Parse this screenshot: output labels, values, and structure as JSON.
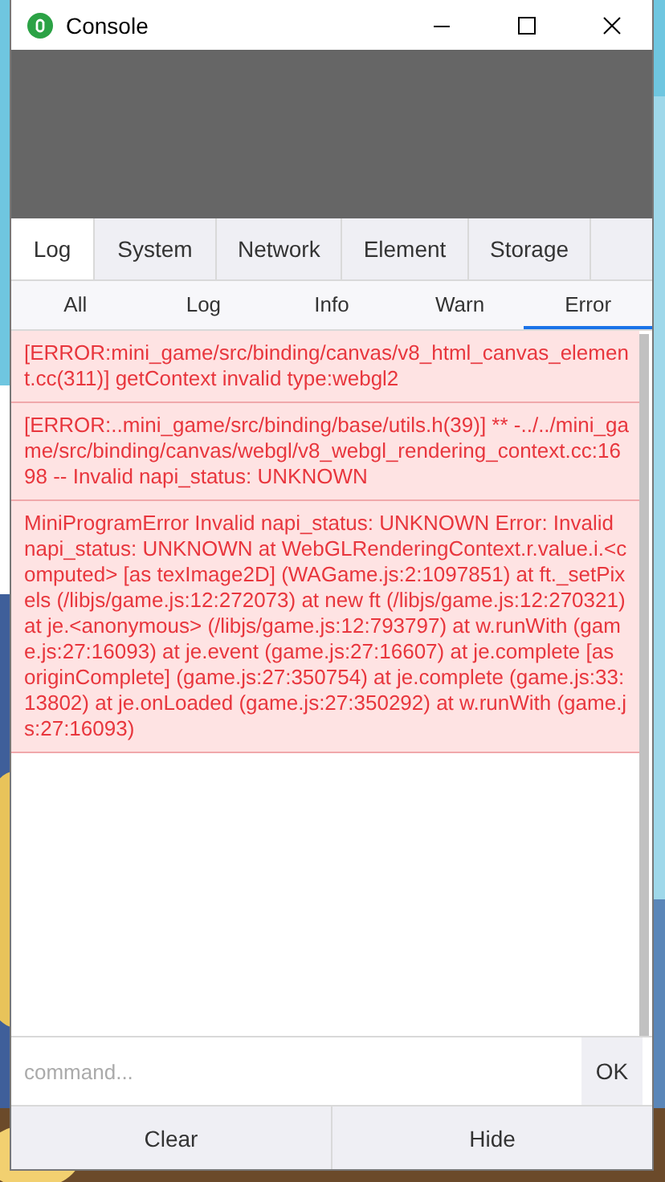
{
  "window": {
    "title": "Console"
  },
  "tabs": [
    {
      "label": "Log",
      "selected": true
    },
    {
      "label": "System",
      "selected": false
    },
    {
      "label": "Network",
      "selected": false
    },
    {
      "label": "Element",
      "selected": false
    },
    {
      "label": "Storage",
      "selected": false
    }
  ],
  "filters": [
    {
      "label": "All",
      "selected": false
    },
    {
      "label": "Log",
      "selected": false
    },
    {
      "label": "Info",
      "selected": false
    },
    {
      "label": "Warn",
      "selected": false
    },
    {
      "label": "Error",
      "selected": true
    }
  ],
  "logs": [
    {
      "kind": "error",
      "text": "[ERROR:mini_game/src/binding/canvas/v8_html_canvas_element.cc(311)] getContext invalid type:webgl2"
    },
    {
      "kind": "error",
      "text": "[ERROR:..mini_game/src/binding/base/utils.h(39)] ** -../../mini_game/src/binding/canvas/webgl/v8_webgl_rendering_context.cc:1698 -- Invalid napi_status: UNKNOWN"
    },
    {
      "kind": "error",
      "text": "MiniProgramError Invalid napi_status: UNKNOWN Error: Invalid napi_status: UNKNOWN at WebGLRenderingContext.r.value.i.<computed> [as texImage2D] (WAGame.js:2:1097851) at ft._setPixels (/libjs/game.js:12:272073) at new ft (/libjs/game.js:12:270321) at je.<anonymous> (/libjs/game.js:12:793797) at w.runWith (game.js:27:16093) at je.event (game.js:27:16607) at je.complete [as originComplete] (game.js:27:350754) at je.complete (game.js:33:13802) at je.onLoaded (game.js:27:350292) at w.runWith (game.js:27:16093)"
    }
  ],
  "command": {
    "placeholder": "command...",
    "button": "OK"
  },
  "buttons": [
    "Clear",
    "Hide"
  ]
}
